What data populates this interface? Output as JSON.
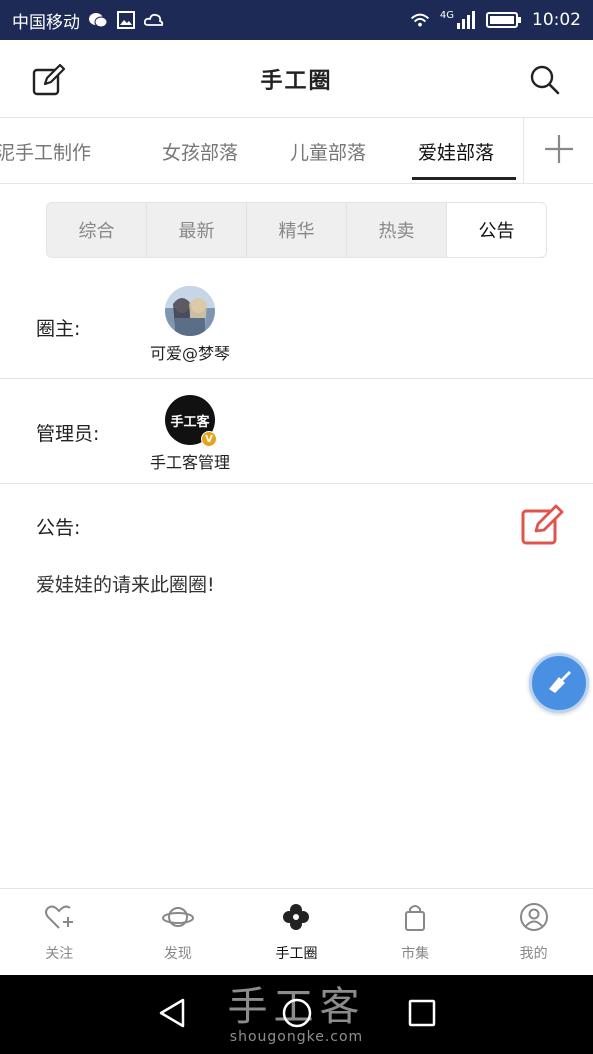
{
  "status_bar": {
    "carrier": "中国移动",
    "network": "4G",
    "time": "10:02"
  },
  "app_bar": {
    "title": "手工圈",
    "left_icon": "edit-icon",
    "right_icon": "search-icon"
  },
  "category_tabs": [
    {
      "label": "泥手工制作"
    },
    {
      "label": "女孩部落"
    },
    {
      "label": "儿童部落"
    },
    {
      "label": "爱娃部落",
      "active": true
    }
  ],
  "segments": [
    {
      "label": "综合"
    },
    {
      "label": "最新"
    },
    {
      "label": "精华"
    },
    {
      "label": "热卖"
    },
    {
      "label": "公告",
      "active": true
    }
  ],
  "owner": {
    "label": "圈主:",
    "name": "可爱@梦琴"
  },
  "admin": {
    "label": "管理员:",
    "name": "手工客管理",
    "avatar_text": "手工客",
    "badge": "V"
  },
  "notice": {
    "label": "公告:",
    "text": "爱娃娃的请来此圈圈!"
  },
  "bottom_nav": [
    {
      "label": "关注",
      "icon": "heart-plus-icon"
    },
    {
      "label": "发现",
      "icon": "planet-icon"
    },
    {
      "label": "手工圈",
      "icon": "flower-icon",
      "active": true
    },
    {
      "label": "市集",
      "icon": "bag-icon"
    },
    {
      "label": "我的",
      "icon": "user-icon"
    }
  ],
  "watermark": {
    "cn": "手工客",
    "en": "shougongke.com"
  },
  "colors": {
    "status_bar": "#1c2a55",
    "accent_red": "#e2534b",
    "fab_blue": "#4a90e2"
  }
}
